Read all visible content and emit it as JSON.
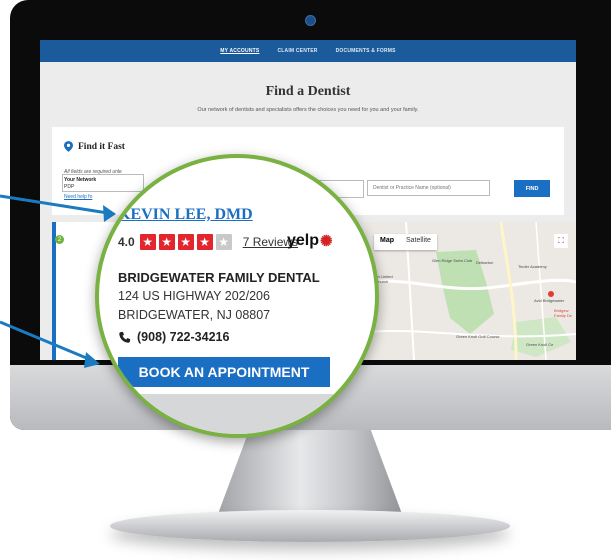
{
  "nav": {
    "items": [
      "MY ACCOUNTS",
      "CLAIM CENTER",
      "DOCUMENTS & FORMS"
    ]
  },
  "page": {
    "title": "Find a Dentist",
    "subtitle": "Our network of dentists and specialists offers the choices you need for you and your family."
  },
  "find_it_fast": {
    "title": "Find it Fast",
    "required_note": "All fields are required unle",
    "network_label": "Your Network",
    "network_value": "PDP",
    "help_link": "Need help fo",
    "dentist_placeholder": "Dentist or Practice Name (optional)",
    "find_button": "FIND"
  },
  "result": {
    "number": "2"
  },
  "map": {
    "tab_map": "Map",
    "tab_satellite": "Satellite",
    "labels": [
      "Glen Ridge Swim Club",
      "Delbarton",
      "Tinder Academy",
      "ewater United",
      "dist Church",
      "Avid Bridgewater",
      "Bridgew",
      "Family De",
      "Green Knoll Golf Course",
      "Green Knoll Ce"
    ]
  },
  "dentist": {
    "name": "KEVIN LEE, DMD",
    "rating": "4.0",
    "stars_filled": 4,
    "stars_total": 5,
    "reviews": "7 Reviews",
    "yelp": "yelp",
    "practice": "BRIDGEWATER FAMILY DENTAL",
    "address1": "124 US HIGHWAY 202/206",
    "address2": "BRIDGEWATER, NJ 08807",
    "phone": "(908) 722-34216",
    "book_button": "BOOK AN APPOINTMENT"
  },
  "colors": {
    "brand_blue": "#1b6fc2",
    "nav_blue": "#1b5a9b",
    "star_red": "#e3252d",
    "ring_green": "#79b142",
    "pointer": "#1b7bc0"
  }
}
